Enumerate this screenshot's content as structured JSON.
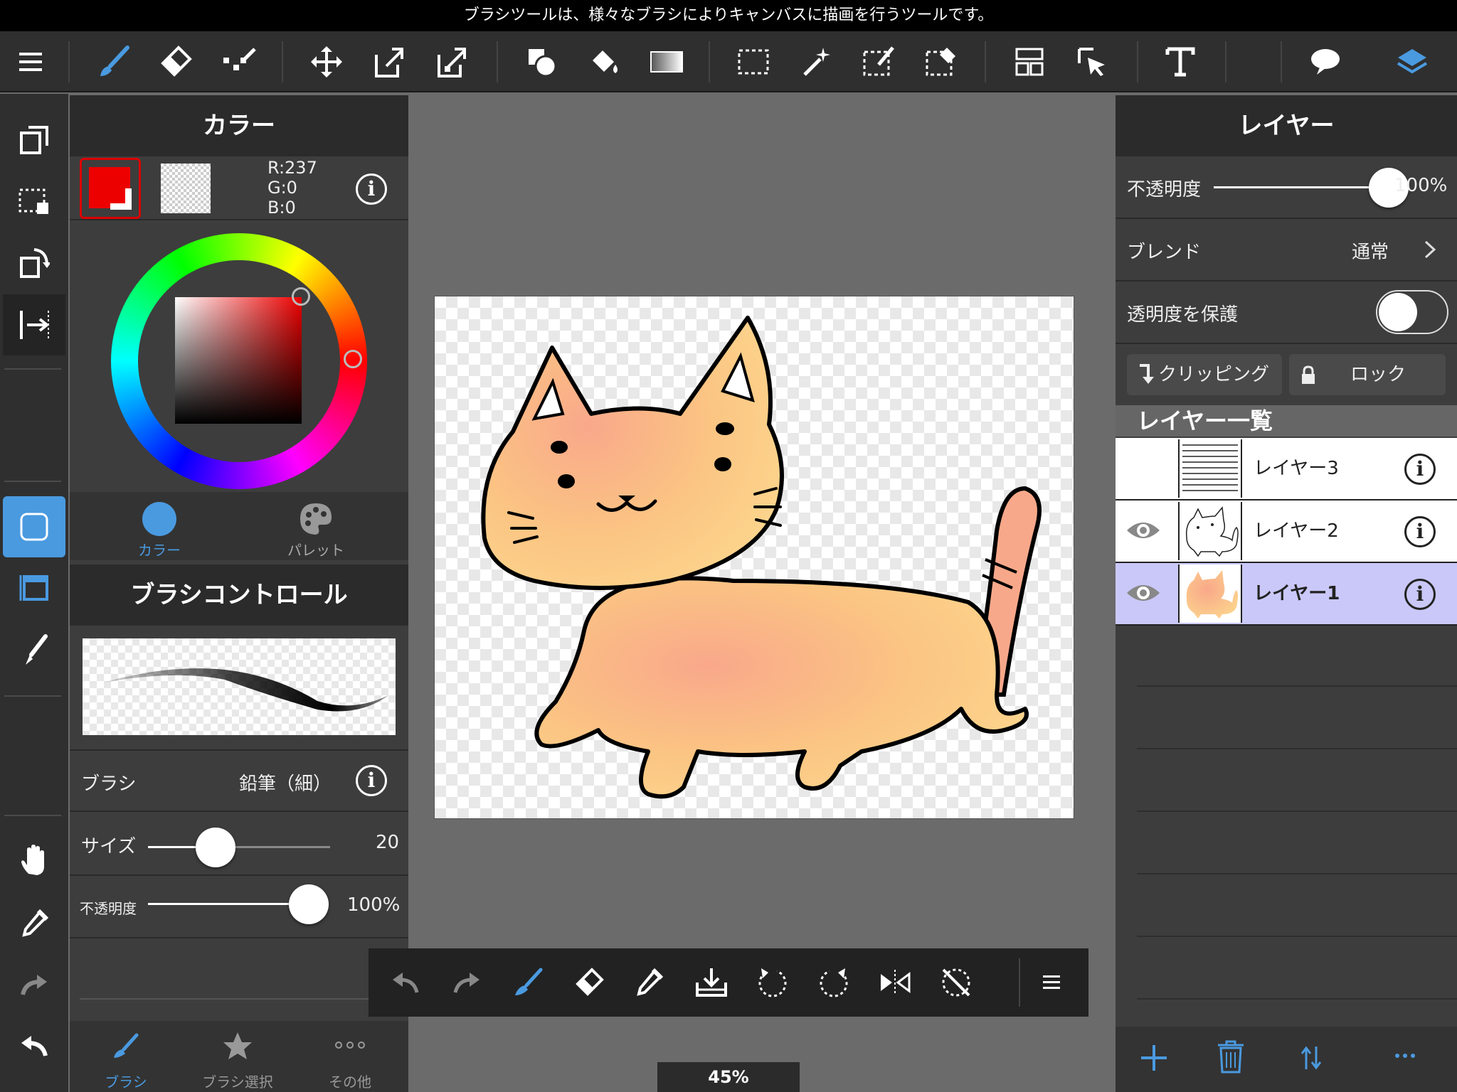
{
  "hint": "ブラシツールは、様々なブラシによりキャンバスに描画を行うツールです。",
  "color_panel": {
    "title": "カラー",
    "main_color": "#ed0000",
    "rgb": {
      "r": "R:237",
      "g": "G:0",
      "b": "B:0"
    },
    "tabs": [
      {
        "label": "カラー",
        "active": true
      },
      {
        "label": "パレット",
        "active": false
      }
    ]
  },
  "brush_control": {
    "title": "ブラシコントロール",
    "brush_label": "ブラシ",
    "brush_value": "鉛筆（細）",
    "size_label": "サイズ",
    "size_value": "20",
    "size_fraction": 0.37,
    "opacity_label": "不透明度",
    "opacity_value": "100%",
    "opacity_fraction": 1.0
  },
  "left_bottom_tabs": [
    {
      "label": "ブラシ",
      "active": true
    },
    {
      "label": "ブラシ選択",
      "active": false
    },
    {
      "label": "その他",
      "active": false
    }
  ],
  "zoom": "45%",
  "layer_panel": {
    "title": "レイヤー",
    "opacity_label": "不透明度",
    "opacity_value": "100%",
    "opacity_fraction": 1.0,
    "blend_label": "ブレンド",
    "blend_value": "通常",
    "protect_label": "透明度を保護",
    "protect_on": false,
    "clipping_label": "クリッピング",
    "lock_label": "ロック",
    "list_title": "レイヤー一覧",
    "layers": [
      {
        "name": "レイヤー3",
        "visible": false,
        "selected": false
      },
      {
        "name": "レイヤー2",
        "visible": true,
        "selected": false
      },
      {
        "name": "レイヤー1",
        "visible": true,
        "selected": true
      }
    ]
  },
  "colors": {
    "accent": "#4a9ae0",
    "selected_layer": "#c9c8f8"
  }
}
